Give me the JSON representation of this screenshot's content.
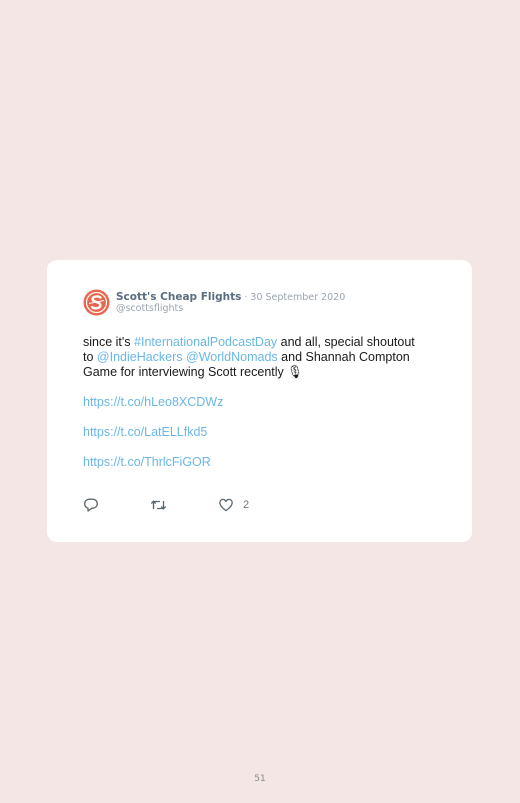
{
  "tweet": {
    "author_name": "Scott's Cheap Flights",
    "separator": " · ",
    "date": "30 September 2020",
    "handle": "@scottsflights",
    "avatar_icon": "scotts-cheap-flights-logo",
    "text": {
      "line1_a": "since it's ",
      "hashtag": "#InternationalPodcastDay",
      "line1_b": " and all, special shoutout",
      "line2_a": "to ",
      "mention1": "@IndieHackers",
      "space": " ",
      "mention2": "@WorldNomads",
      "line2_b": " and Shannah Compton",
      "line3": "Game for interviewing Scott recently 🎙",
      "link1": "https://t.co/hLeo8XCDWz",
      "link2": "https://t.co/LatELLfkd5",
      "link3": "https://t.co/ThrlcFiGOR"
    },
    "actions": {
      "reply_icon": "reply-icon",
      "retweet_icon": "retweet-icon",
      "like_icon": "heart-icon",
      "like_count": "2"
    },
    "colors": {
      "link": "#6ab7e6",
      "logo": "#e8664d",
      "background": "#f5e6e6"
    }
  },
  "page": {
    "number": "51"
  }
}
